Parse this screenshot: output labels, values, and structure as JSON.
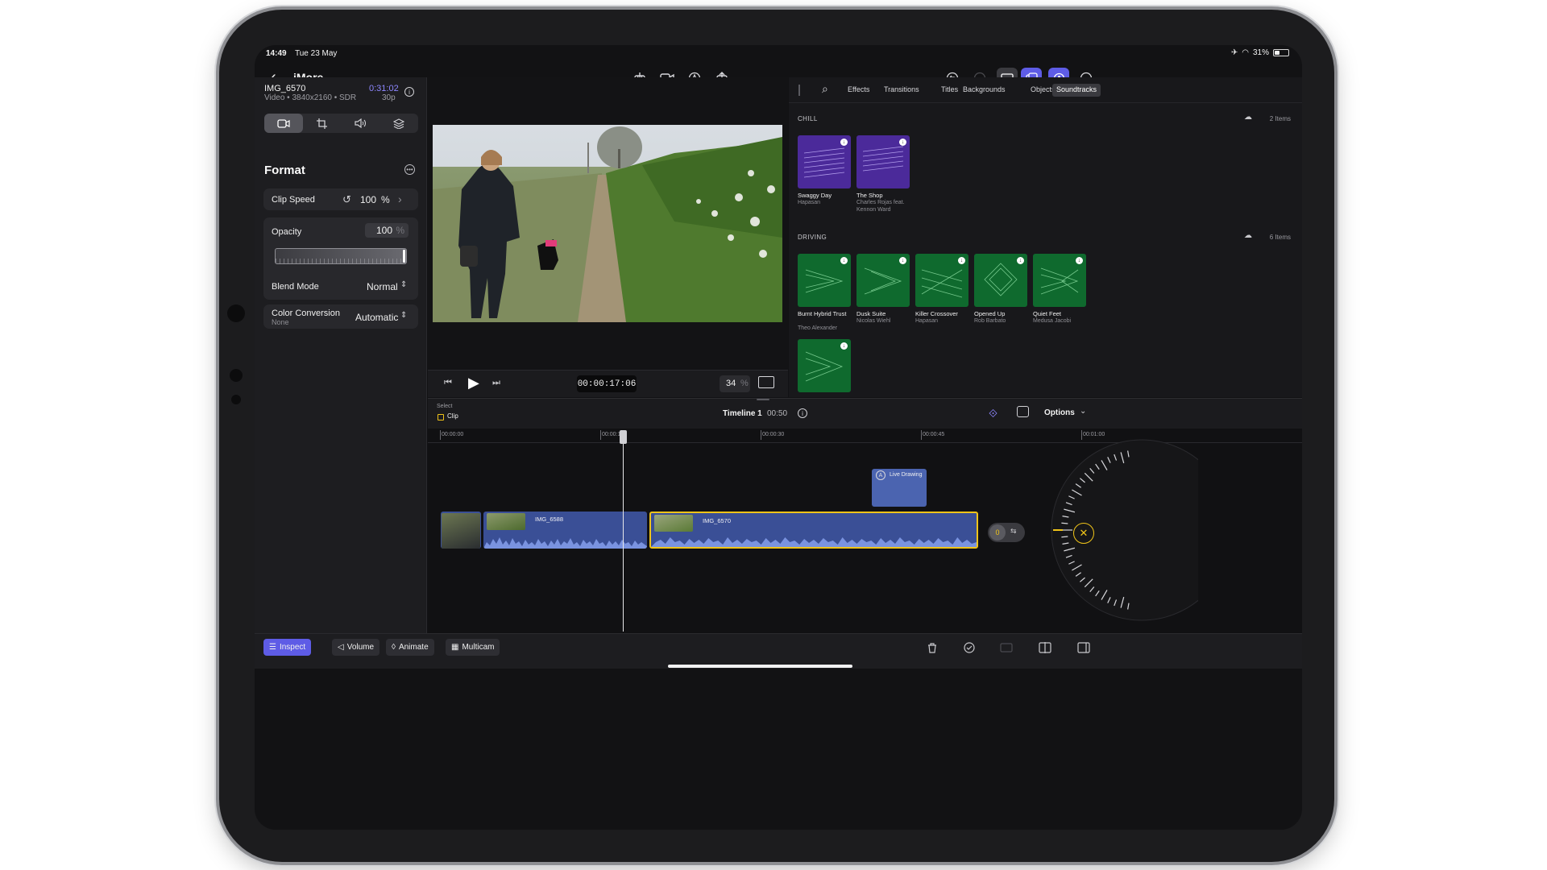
{
  "status": {
    "time": "14:49",
    "date": "Tue 23 May",
    "battery": "31%"
  },
  "topbar": {
    "back_icon": "chevron-left-icon",
    "project": "iMore"
  },
  "inspector": {
    "clip_name": "IMG_6570",
    "clip_meta": "Video • 3840x2160 • SDR",
    "duration": "0:31:02",
    "fps": "30p",
    "section_title": "Format",
    "clip_speed": {
      "label": "Clip Speed",
      "value": "100",
      "unit": "%"
    },
    "opacity": {
      "label": "Opacity",
      "value": "100",
      "unit": "%",
      "level": 1.0
    },
    "blend": {
      "label": "Blend Mode",
      "value": "Normal"
    },
    "color_conversion": {
      "label": "Color Conversion",
      "sub": "None",
      "value": "Automatic"
    }
  },
  "viewer": {
    "timecode": "00:00:17:06",
    "zoom": "34",
    "zoom_unit": "%"
  },
  "browser": {
    "tabs": [
      "Effects",
      "Transitions",
      "Titles",
      "Backgrounds",
      "Objects",
      "Soundtracks"
    ],
    "active_tab": "Soundtracks",
    "sections": [
      {
        "name": "CHILL",
        "count": "2 Items",
        "items": [
          {
            "title": "Swaggy Day",
            "artist": "Hapasan"
          },
          {
            "title": "The Shop",
            "artist": "Charles Rojas feat. Kennon Ward"
          }
        ]
      },
      {
        "name": "DRIVING",
        "count": "6 Items",
        "items": [
          {
            "title": "Burnt Hybrid Trust",
            "artist": "Theo Alexander"
          },
          {
            "title": "Dusk Suite",
            "artist": "Nicolas Wiehl"
          },
          {
            "title": "Killer Crossover",
            "artist": "Hapasan"
          },
          {
            "title": "Opened Up",
            "artist": "Rob Barbato"
          },
          {
            "title": "Quiet Feet",
            "artist": "Medusa Jacobi"
          },
          {
            "title": "",
            "artist": ""
          }
        ]
      }
    ],
    "colors": {
      "chill": "#4b2a9a",
      "driving": "#0f6a2e"
    }
  },
  "timeline": {
    "select_label": "Select",
    "clip_label": "Clip",
    "name": "Timeline 1",
    "duration": "00:50",
    "options": "Options",
    "ruler": [
      "00:00:00",
      "00:00:15",
      "00:00:30",
      "00:00:45",
      "00:01:00"
    ],
    "clips": [
      "IMG_6588",
      "IMG_6570"
    ],
    "live_drawing": "Live Drawing",
    "toggle_value": "0"
  },
  "bottombar": {
    "inspect": "Inspect",
    "volume": "Volume",
    "animate": "Animate",
    "multicam": "Multicam"
  }
}
